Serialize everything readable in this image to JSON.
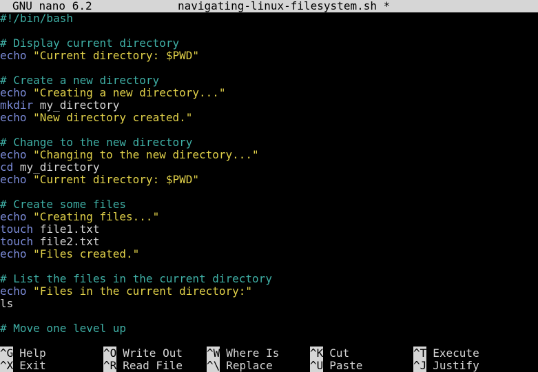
{
  "titlebar": {
    "app": "GNU nano 6.2",
    "filename": "navigating-linux-filesystem.sh *"
  },
  "colors": {
    "comment": "#3fb0a6",
    "keyword": "#7b8bd8",
    "string": "#e2d24a",
    "text": "#d6d6d6",
    "background": "#000000"
  },
  "lines": [
    {
      "segments": [
        {
          "t": "#!/bin/bash",
          "c": "comment"
        }
      ]
    },
    {
      "segments": []
    },
    {
      "segments": [
        {
          "t": "# Display current directory",
          "c": "comment"
        }
      ]
    },
    {
      "segments": [
        {
          "t": "echo",
          "c": "kw"
        },
        {
          "t": " ",
          "c": "plain"
        },
        {
          "t": "\"Current directory: $PWD\"",
          "c": "str"
        }
      ]
    },
    {
      "segments": []
    },
    {
      "segments": [
        {
          "t": "# Create a new directory",
          "c": "comment"
        }
      ]
    },
    {
      "segments": [
        {
          "t": "echo",
          "c": "kw"
        },
        {
          "t": " ",
          "c": "plain"
        },
        {
          "t": "\"Creating a new directory...\"",
          "c": "str"
        }
      ]
    },
    {
      "segments": [
        {
          "t": "mkdir",
          "c": "kw"
        },
        {
          "t": " my_directory",
          "c": "plain"
        }
      ]
    },
    {
      "segments": [
        {
          "t": "echo",
          "c": "kw"
        },
        {
          "t": " ",
          "c": "plain"
        },
        {
          "t": "\"New directory created.\"",
          "c": "str"
        }
      ]
    },
    {
      "segments": []
    },
    {
      "segments": [
        {
          "t": "# Change to the new directory",
          "c": "comment"
        }
      ]
    },
    {
      "segments": [
        {
          "t": "echo",
          "c": "kw"
        },
        {
          "t": " ",
          "c": "plain"
        },
        {
          "t": "\"Changing to the new directory...\"",
          "c": "str"
        }
      ]
    },
    {
      "segments": [
        {
          "t": "cd",
          "c": "kw"
        },
        {
          "t": " my_directory",
          "c": "plain"
        }
      ]
    },
    {
      "segments": [
        {
          "t": "echo",
          "c": "kw"
        },
        {
          "t": " ",
          "c": "plain"
        },
        {
          "t": "\"Current directory: $PWD\"",
          "c": "str"
        }
      ]
    },
    {
      "segments": []
    },
    {
      "segments": [
        {
          "t": "# Create some files",
          "c": "comment"
        }
      ]
    },
    {
      "segments": [
        {
          "t": "echo",
          "c": "kw"
        },
        {
          "t": " ",
          "c": "plain"
        },
        {
          "t": "\"Creating files...\"",
          "c": "str"
        }
      ]
    },
    {
      "segments": [
        {
          "t": "touch",
          "c": "kw"
        },
        {
          "t": " file1.txt",
          "c": "plain"
        }
      ]
    },
    {
      "segments": [
        {
          "t": "touch",
          "c": "kw"
        },
        {
          "t": " file2.txt",
          "c": "plain"
        }
      ]
    },
    {
      "segments": [
        {
          "t": "echo",
          "c": "kw"
        },
        {
          "t": " ",
          "c": "plain"
        },
        {
          "t": "\"Files created.\"",
          "c": "str"
        }
      ]
    },
    {
      "segments": []
    },
    {
      "segments": [
        {
          "t": "# List the files in the current directory",
          "c": "comment"
        }
      ]
    },
    {
      "segments": [
        {
          "t": "echo",
          "c": "kw"
        },
        {
          "t": " ",
          "c": "plain"
        },
        {
          "t": "\"Files in the current directory:\"",
          "c": "str"
        }
      ]
    },
    {
      "segments": [
        {
          "t": "ls",
          "c": "plain"
        }
      ]
    },
    {
      "segments": []
    },
    {
      "segments": [
        {
          "t": "# Move one level up",
          "c": "comment"
        }
      ]
    }
  ],
  "shortcuts": {
    "help": {
      "key": "^G",
      "label": "Help"
    },
    "exit": {
      "key": "^X",
      "label": "Exit"
    },
    "write": {
      "key": "^O",
      "label": "Write Out"
    },
    "read": {
      "key": "^R",
      "label": "Read File"
    },
    "where": {
      "key": "^W",
      "label": "Where Is"
    },
    "replace": {
      "key": "^\\",
      "label": "Replace"
    },
    "cut": {
      "key": "^K",
      "label": "Cut"
    },
    "paste": {
      "key": "^U",
      "label": "Paste"
    },
    "execute": {
      "key": "^T",
      "label": "Execute"
    },
    "justify": {
      "key": "^J",
      "label": "Justify"
    }
  }
}
